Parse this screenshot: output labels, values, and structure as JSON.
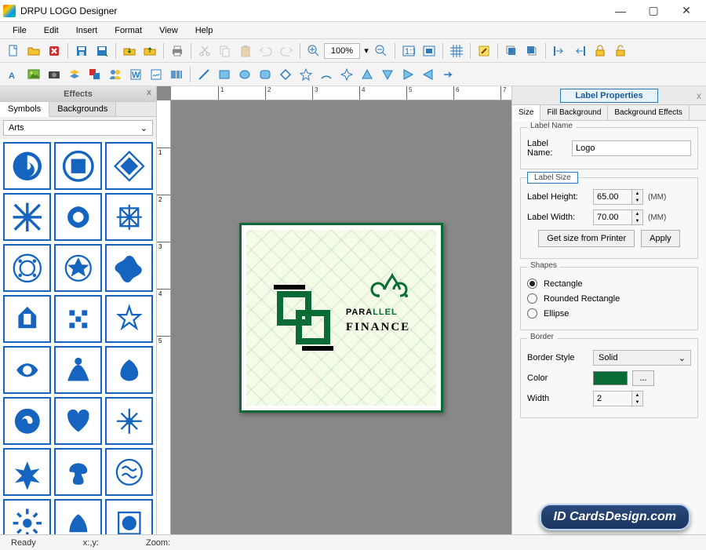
{
  "app": {
    "title": "DRPU LOGO Designer"
  },
  "menu": {
    "items": [
      "File",
      "Edit",
      "Insert",
      "Format",
      "View",
      "Help"
    ]
  },
  "toolbar": {
    "zoom_value": "100%"
  },
  "effects_panel": {
    "title": "Effects",
    "tabs": [
      "Symbols",
      "Backgrounds"
    ],
    "active_tab": 0,
    "category": "Arts"
  },
  "canvas": {
    "logo_line1_a": "PARA",
    "logo_line1_b": "LLEL",
    "logo_line2": "FINANCE",
    "ruler_h": [
      "1",
      "2",
      "3",
      "4",
      "5",
      "6",
      "7"
    ],
    "ruler_v": [
      "1",
      "2",
      "3",
      "4",
      "5"
    ]
  },
  "properties": {
    "title": "Label Properties",
    "tabs": [
      "Size",
      "Fill Background",
      "Background Effects"
    ],
    "active_tab": 0,
    "label_name_legend": "Label Name",
    "label_name_label": "Label Name:",
    "label_name_value": "Logo",
    "label_size_legend": "Label Size",
    "height_label": "Label Height:",
    "height_value": "65.00",
    "width_label": "Label Width:",
    "width_value": "70.00",
    "unit": "(MM)",
    "get_size_btn": "Get size from Printer",
    "apply_btn": "Apply",
    "shapes_legend": "Shapes",
    "shapes": [
      "Rectangle",
      "Rounded Rectangle",
      "Ellipse"
    ],
    "selected_shape": 0,
    "border_legend": "Border",
    "border_style_label": "Border Style",
    "border_style_value": "Solid",
    "color_label": "Color",
    "color_value": "#0a6b35",
    "width_label2": "Width",
    "width_value2": "2"
  },
  "status": {
    "ready": "Ready",
    "xy": "x:,y:",
    "zoom": "Zoom:"
  },
  "badge": "ID CardsDesign.com"
}
